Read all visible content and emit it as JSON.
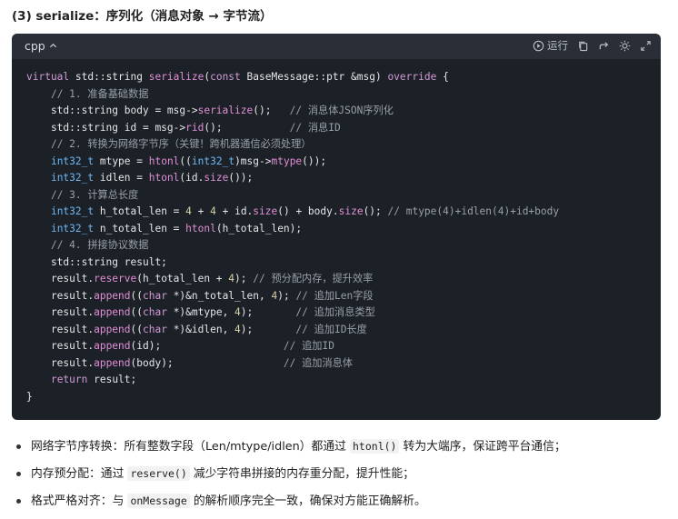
{
  "heading": {
    "prefix": "(3) serialize：",
    "title": "序列化（消息对象 → 字节流）"
  },
  "code_block": {
    "language": "cpp",
    "toolbar": {
      "run_label": "运行"
    },
    "lines": [
      [
        [
          "kw",
          "virtual"
        ],
        [
          "p",
          " std::string "
        ],
        [
          "fn",
          "serialize"
        ],
        [
          "p",
          "("
        ],
        [
          "kw",
          "const"
        ],
        [
          "p",
          " BaseMessage::ptr &msg) "
        ],
        [
          "kw",
          "override"
        ],
        [
          "p",
          " {"
        ]
      ],
      [
        [
          "p",
          "    "
        ],
        [
          "cm",
          "// 1. 准备基础数据"
        ]
      ],
      [
        [
          "p",
          "    std::string body = msg->"
        ],
        [
          "fn",
          "serialize"
        ],
        [
          "p",
          "();   "
        ],
        [
          "cm",
          "// 消息体JSON序列化"
        ]
      ],
      [
        [
          "p",
          "    std::string id = msg->"
        ],
        [
          "fn",
          "rid"
        ],
        [
          "p",
          "();           "
        ],
        [
          "cm",
          "// 消息ID"
        ]
      ],
      [
        [
          "p",
          "    "
        ],
        [
          "cm",
          "// 2. 转换为网络字节序（关键！跨机器通信必须处理）"
        ]
      ],
      [
        [
          "p",
          "    "
        ],
        [
          "ty",
          "int32_t"
        ],
        [
          "p",
          " mtype = "
        ],
        [
          "fn",
          "htonl"
        ],
        [
          "p",
          "(("
        ],
        [
          "ty",
          "int32_t"
        ],
        [
          "p",
          ")msg->"
        ],
        [
          "fn",
          "mtype"
        ],
        [
          "p",
          "());"
        ]
      ],
      [
        [
          "p",
          "    "
        ],
        [
          "ty",
          "int32_t"
        ],
        [
          "p",
          " idlen = "
        ],
        [
          "fn",
          "htonl"
        ],
        [
          "p",
          "(id."
        ],
        [
          "fn",
          "size"
        ],
        [
          "p",
          "());"
        ]
      ],
      [
        [
          "p",
          "    "
        ],
        [
          "cm",
          "// 3. 计算总长度"
        ]
      ],
      [
        [
          "p",
          "    "
        ],
        [
          "ty",
          "int32_t"
        ],
        [
          "p",
          " h_total_len = "
        ],
        [
          "nm",
          "4"
        ],
        [
          "p",
          " + "
        ],
        [
          "nm",
          "4"
        ],
        [
          "p",
          " + id."
        ],
        [
          "fn",
          "size"
        ],
        [
          "p",
          "() + body."
        ],
        [
          "fn",
          "size"
        ],
        [
          "p",
          "(); "
        ],
        [
          "cm",
          "// mtype(4)+idlen(4)+id+body"
        ]
      ],
      [
        [
          "p",
          "    "
        ],
        [
          "ty",
          "int32_t"
        ],
        [
          "p",
          " n_total_len = "
        ],
        [
          "fn",
          "htonl"
        ],
        [
          "p",
          "(h_total_len);"
        ]
      ],
      [
        [
          "p",
          "    "
        ],
        [
          "cm",
          "// 4. 拼接协议数据"
        ]
      ],
      [
        [
          "p",
          "    std::string result;"
        ]
      ],
      [
        [
          "p",
          "    result."
        ],
        [
          "fn",
          "reserve"
        ],
        [
          "p",
          "(h_total_len + "
        ],
        [
          "nm",
          "4"
        ],
        [
          "p",
          "); "
        ],
        [
          "cm",
          "// 预分配内存，提升效率"
        ]
      ],
      [
        [
          "p",
          "    result."
        ],
        [
          "fn",
          "append"
        ],
        [
          "p",
          "(("
        ],
        [
          "kw",
          "char"
        ],
        [
          "p",
          " *)&n_total_len, "
        ],
        [
          "nm",
          "4"
        ],
        [
          "p",
          "); "
        ],
        [
          "cm",
          "// 追加Len字段"
        ]
      ],
      [
        [
          "p",
          "    result."
        ],
        [
          "fn",
          "append"
        ],
        [
          "p",
          "(("
        ],
        [
          "kw",
          "char"
        ],
        [
          "p",
          " *)&mtype, "
        ],
        [
          "nm",
          "4"
        ],
        [
          "p",
          ");       "
        ],
        [
          "cm",
          "// 追加消息类型"
        ]
      ],
      [
        [
          "p",
          "    result."
        ],
        [
          "fn",
          "append"
        ],
        [
          "p",
          "(("
        ],
        [
          "kw",
          "char"
        ],
        [
          "p",
          " *)&idlen, "
        ],
        [
          "nm",
          "4"
        ],
        [
          "p",
          ");       "
        ],
        [
          "cm",
          "// 追加ID长度"
        ]
      ],
      [
        [
          "p",
          "    result."
        ],
        [
          "fn",
          "append"
        ],
        [
          "p",
          "(id);                    "
        ],
        [
          "cm",
          "// 追加ID"
        ]
      ],
      [
        [
          "p",
          "    result."
        ],
        [
          "fn",
          "append"
        ],
        [
          "p",
          "(body);                  "
        ],
        [
          "cm",
          "// 追加消息体"
        ]
      ],
      [
        [
          "p",
          "    "
        ],
        [
          "kw",
          "return"
        ],
        [
          "p",
          " result;"
        ]
      ],
      [
        [
          "p",
          "}"
        ]
      ]
    ]
  },
  "bullets": [
    {
      "text_before": "网络字节序转换：所有整数字段（Len/mtype/idlen）都通过 ",
      "code": "htonl()",
      "text_after": " 转为大端序，保证跨平台通信；"
    },
    {
      "text_before": "内存预分配：通过 ",
      "code": "reserve()",
      "text_after": " 减少字符串拼接的内存重分配，提升性能；"
    },
    {
      "text_before": "格式严格对齐：与 ",
      "code": "onMessage",
      "text_after": " 的解析顺序完全一致，确保对方能正确解析。"
    }
  ]
}
